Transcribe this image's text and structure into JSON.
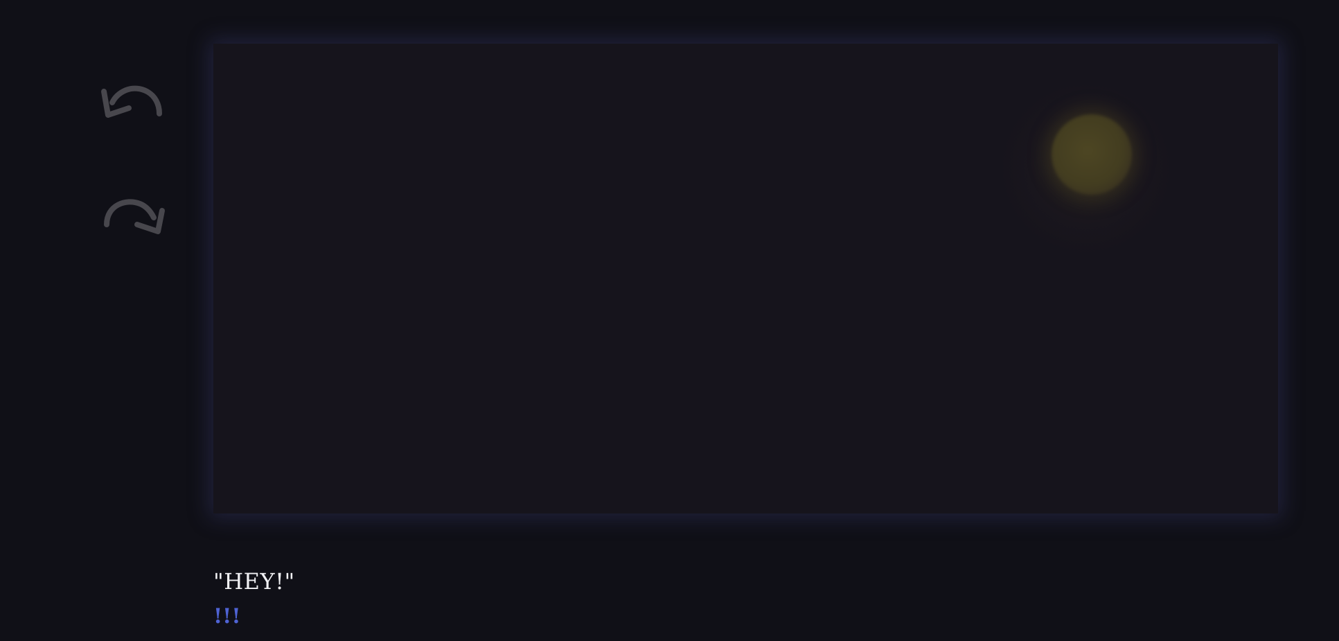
{
  "controls": {
    "undo_icon": "undo-arrow-icon",
    "redo_icon": "redo-arrow-icon",
    "icon_color": "#48474d"
  },
  "scene": {
    "background": "#16141c",
    "glow_color": "#3c3e78",
    "moon_color": "#4d4623"
  },
  "dialogue": {
    "speech": "\"HEY!\"",
    "reaction": "!!!",
    "speech_color": "#f1f1f4",
    "reaction_color": "#4f63d4"
  }
}
